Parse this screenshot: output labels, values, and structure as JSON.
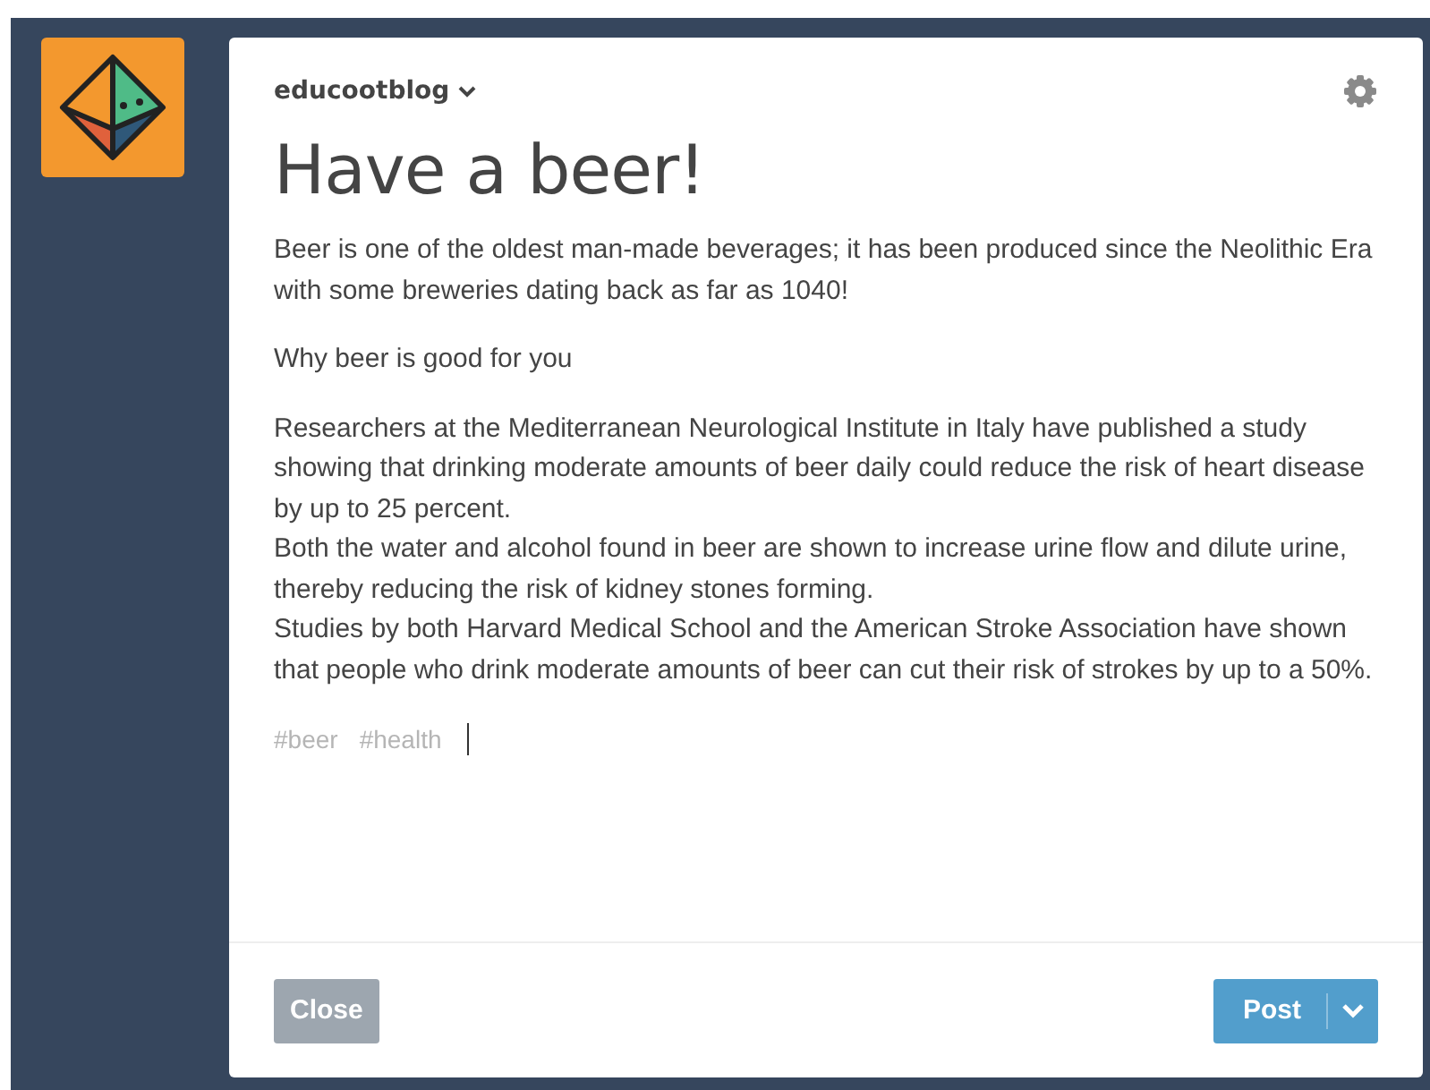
{
  "blog": {
    "name": "educootblog"
  },
  "post": {
    "title": "Have a beer!",
    "paragraphs": [
      [
        "Beer is one of the oldest man-made beverages; it has been produced since the Neolithic Era with some breweries dating back as far as 1040!"
      ],
      [
        "Why beer is good for you"
      ],
      [
        "Researchers at the Mediterranean Neurological Institute in Italy have published a study showing that drinking moderate amounts of beer daily could reduce the risk of heart disease by up to 25 percent.",
        "Both the water and alcohol found in beer are shown to increase urine flow and dilute urine, thereby reducing the risk of kidney stones forming.",
        "Studies by both Harvard Medical School and the American Stroke Association have shown that people who drink moderate amounts of beer can cut their risk of strokes by up to a 50%."
      ]
    ],
    "tags": [
      "#beer",
      "#health"
    ]
  },
  "buttons": {
    "close": "Close",
    "post": "Post"
  }
}
